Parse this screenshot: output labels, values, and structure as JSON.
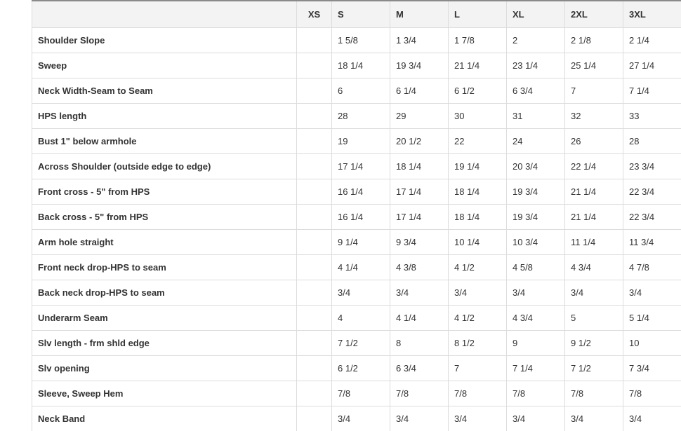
{
  "table": {
    "headers": [
      "",
      "XS",
      "S",
      "M",
      "L",
      "XL",
      "2XL",
      "3XL"
    ],
    "rows": [
      {
        "label": "Shoulder Slope",
        "values": [
          "",
          "1 5/8",
          "1 3/4",
          "1 7/8",
          "2",
          "2 1/8",
          "2 1/4"
        ]
      },
      {
        "label": "Sweep",
        "values": [
          "",
          "18 1/4",
          "19 3/4",
          "21 1/4",
          "23 1/4",
          "25 1/4",
          "27 1/4"
        ]
      },
      {
        "label": "Neck Width-Seam to Seam",
        "values": [
          "",
          "6",
          "6 1/4",
          "6 1/2",
          "6 3/4",
          "7",
          "7 1/4"
        ]
      },
      {
        "label": "HPS length",
        "values": [
          "",
          "28",
          "29",
          "30",
          "31",
          "32",
          "33"
        ]
      },
      {
        "label": "Bust 1\" below armhole",
        "values": [
          "",
          "19",
          "20 1/2",
          "22",
          "24",
          "26",
          "28"
        ]
      },
      {
        "label": "Across Shoulder (outside edge to edge)",
        "values": [
          "",
          "17 1/4",
          "18 1/4",
          "19 1/4",
          "20 3/4",
          "22 1/4",
          "23 3/4"
        ]
      },
      {
        "label": "Front cross - 5\" from HPS",
        "values": [
          "",
          "16 1/4",
          "17 1/4",
          "18 1/4",
          "19 3/4",
          "21 1/4",
          "22 3/4"
        ]
      },
      {
        "label": "Back cross - 5\" from HPS",
        "values": [
          "",
          "16 1/4",
          "17 1/4",
          "18 1/4",
          "19 3/4",
          "21 1/4",
          "22 3/4"
        ]
      },
      {
        "label": "Arm hole straight",
        "values": [
          "",
          "9 1/4",
          "9 3/4",
          "10 1/4",
          "10 3/4",
          "11 1/4",
          "11 3/4"
        ]
      },
      {
        "label": "Front neck drop-HPS to seam",
        "values": [
          "",
          "4 1/4",
          "4 3/8",
          "4 1/2",
          "4 5/8",
          "4 3/4",
          "4 7/8"
        ]
      },
      {
        "label": "Back neck drop-HPS to seam",
        "values": [
          "",
          "3/4",
          "3/4",
          "3/4",
          "3/4",
          "3/4",
          "3/4"
        ]
      },
      {
        "label": "Underarm Seam",
        "values": [
          "",
          "4",
          "4 1/4",
          "4 1/2",
          "4 3/4",
          "5",
          "5 1/4"
        ]
      },
      {
        "label": "Slv length - frm shld edge",
        "values": [
          "",
          "7 1/2",
          "8",
          "8 1/2",
          "9",
          "9 1/2",
          "10"
        ]
      },
      {
        "label": "Slv opening",
        "values": [
          "",
          "6 1/2",
          "6 3/4",
          "7",
          "7 1/4",
          "7 1/2",
          "7 3/4"
        ]
      },
      {
        "label": "Sleeve, Sweep Hem",
        "values": [
          "",
          "7/8",
          "7/8",
          "7/8",
          "7/8",
          "7/8",
          "7/8"
        ]
      },
      {
        "label": "Neck Band",
        "values": [
          "",
          "3/4",
          "3/4",
          "3/4",
          "3/4",
          "3/4",
          "3/4"
        ]
      }
    ]
  }
}
